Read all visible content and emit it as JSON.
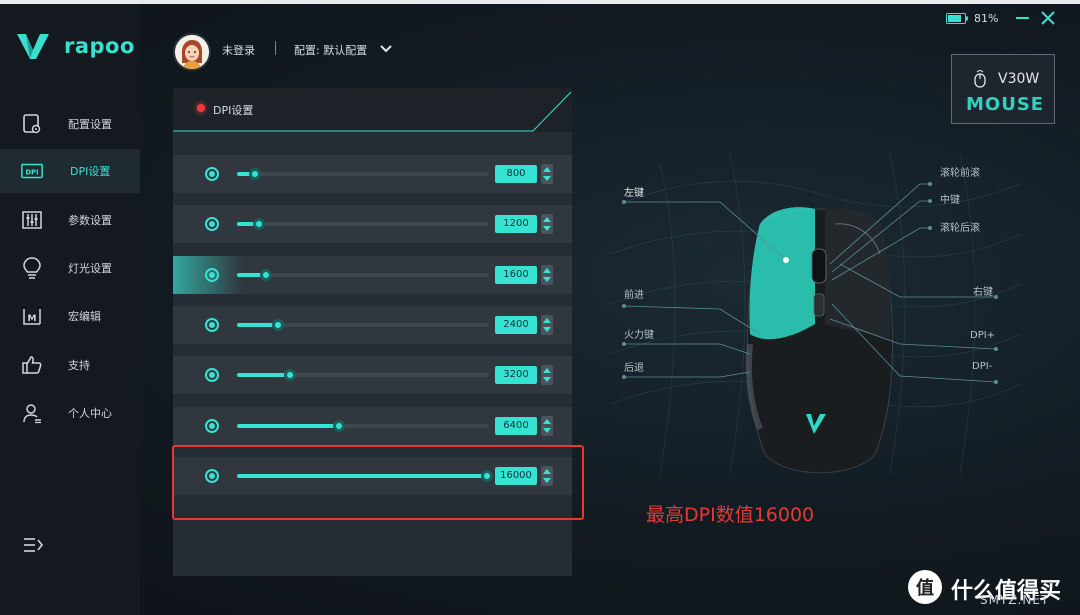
{
  "window": {
    "battery_pct": "81%",
    "battery_level": 0.81
  },
  "brand": {
    "logo_text": "rapoo"
  },
  "sidebar": {
    "items": [
      {
        "label": "配置设置",
        "icon": "profile-settings-icon"
      },
      {
        "label": "DPI设置",
        "icon": "dpi-icon",
        "active": true
      },
      {
        "label": "参数设置",
        "icon": "sliders-icon"
      },
      {
        "label": "灯光设置",
        "icon": "lightbulb-icon"
      },
      {
        "label": "宏编辑",
        "icon": "macro-icon"
      },
      {
        "label": "支持",
        "icon": "thumbs-up-icon"
      },
      {
        "label": "个人中心",
        "icon": "user-icon"
      }
    ],
    "menu_icon": "menu-icon"
  },
  "header": {
    "login_status": "未登录",
    "config_label": "配置: 默认配置"
  },
  "device": {
    "model": "V30W",
    "type": "MOUSE"
  },
  "dpi_panel": {
    "title": "DPI设置",
    "max_dpi": 16000,
    "levels": [
      {
        "value": "800",
        "level": 800
      },
      {
        "value": "1200",
        "level": 1200
      },
      {
        "value": "1600",
        "level": 1600,
        "active": true
      },
      {
        "value": "2400",
        "level": 2400
      },
      {
        "value": "3200",
        "level": 3200
      },
      {
        "value": "6400",
        "level": 6400
      },
      {
        "value": "16000",
        "level": 16000
      }
    ]
  },
  "mouse_callouts": {
    "left_button": "左键",
    "scroll_up": "滚轮前滚",
    "middle": "中键",
    "scroll_down": "滚轮后滚",
    "right_button": "右键",
    "forward": "前进",
    "fire_key": "火力键",
    "back": "后退",
    "dpi_plus": "DPI+",
    "dpi_minus": "DPI-"
  },
  "annotation": "最高DPI数值16000",
  "watermark": {
    "text": "什么值得买",
    "sub": "SMYZ.NET"
  },
  "colors": {
    "accent": "#36e3d2",
    "highlight": "#e53935"
  }
}
